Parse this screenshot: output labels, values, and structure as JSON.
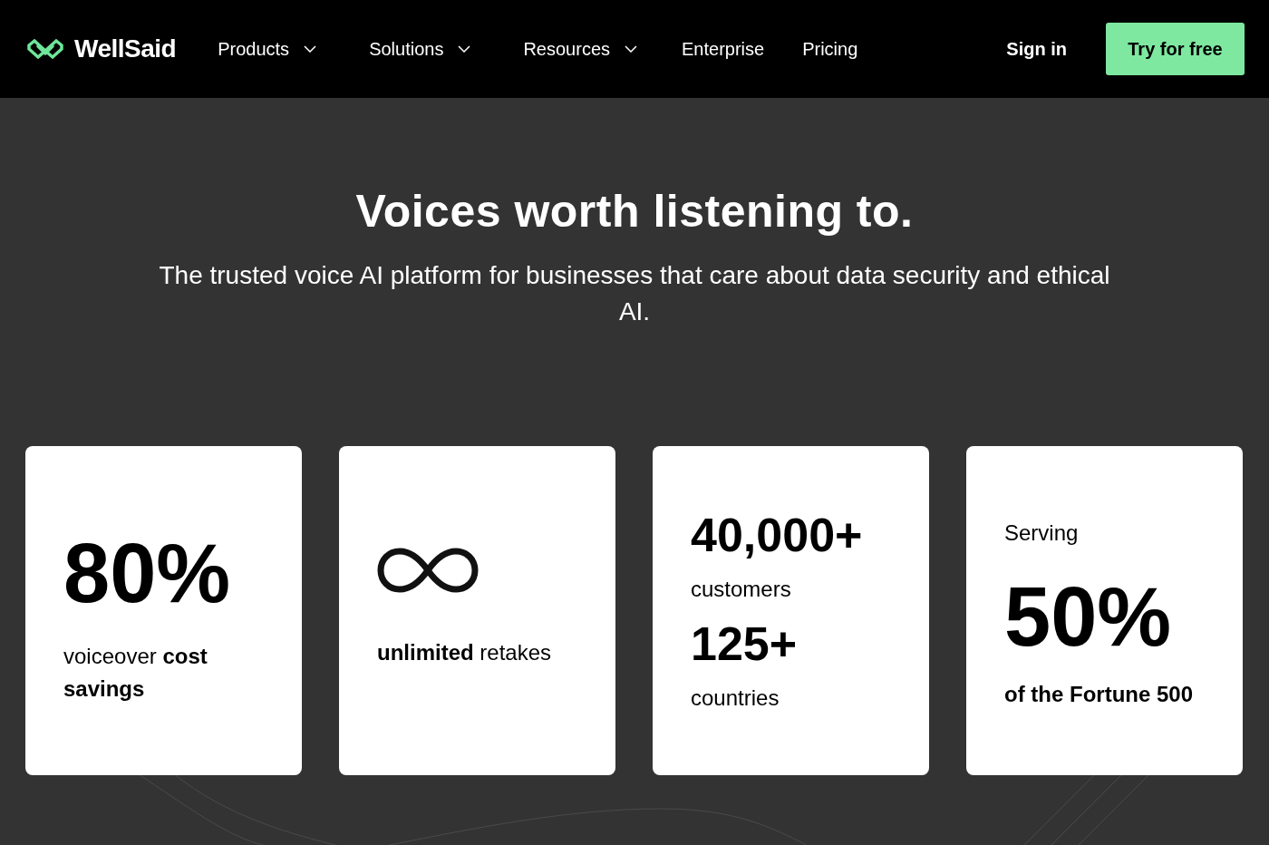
{
  "header": {
    "brand": "WellSaid",
    "nav": [
      {
        "label": "Products",
        "dropdown": true
      },
      {
        "label": "Solutions",
        "dropdown": true
      },
      {
        "label": "Resources",
        "dropdown": true
      },
      {
        "label": "Enterprise",
        "dropdown": false
      },
      {
        "label": "Pricing",
        "dropdown": false
      }
    ],
    "sign_in": "Sign in",
    "cta": "Try for free"
  },
  "hero": {
    "title": "Voices worth listening to.",
    "subtitle": "The trusted voice AI platform for businesses that care about data security and ethical AI."
  },
  "cards": [
    {
      "items": [
        {
          "kind": "big_number",
          "value": "80%"
        },
        {
          "kind": "caption",
          "text": "voiceover **cost savings**"
        }
      ]
    },
    {
      "items": [
        {
          "kind": "infinity"
        },
        {
          "kind": "caption",
          "text": "**unlimited** retakes"
        }
      ]
    },
    {
      "items": [
        {
          "kind": "number",
          "value": "40,000+"
        },
        {
          "kind": "caption",
          "text": "customers"
        },
        {
          "kind": "number",
          "value": "125+"
        },
        {
          "kind": "caption",
          "text": "countries"
        }
      ]
    },
    {
      "items": [
        {
          "kind": "caption",
          "text": "Serving"
        },
        {
          "kind": "big_number",
          "value": "50%"
        },
        {
          "kind": "strong_caption",
          "label": "of the Fortune 500"
        }
      ]
    }
  ]
}
